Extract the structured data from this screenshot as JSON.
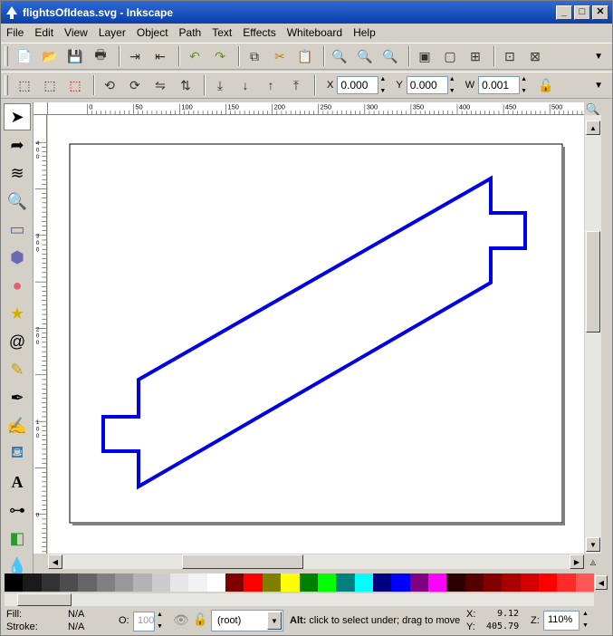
{
  "window": {
    "title": "flightsOfIdeas.svg - Inkscape",
    "minimize_icon": "minimize-icon",
    "maximize_icon": "maximize-icon",
    "close_icon": "close-icon"
  },
  "menu": [
    "File",
    "Edit",
    "View",
    "Layer",
    "Object",
    "Path",
    "Text",
    "Effects",
    "Whiteboard",
    "Help"
  ],
  "toolbar_commands": [
    "new-document-icon",
    "open-icon",
    "save-icon",
    "print-icon",
    "import-icon",
    "export-icon",
    "undo-icon",
    "redo-icon",
    "duplicate-icon",
    "cut-icon",
    "paste-icon",
    "zoom-selection-icon",
    "zoom-drawing-icon",
    "zoom-page-icon",
    "group-icon",
    "ungroup-icon",
    "align-icon",
    "fill-stroke-icon",
    "xml-editor-icon"
  ],
  "selector_toolbar": {
    "x_label": "X",
    "x_value": "0.000",
    "y_label": "Y",
    "y_value": "0.000",
    "w_label": "W",
    "w_value": "0.001",
    "lock_icon": "lock-icon"
  },
  "tools": [
    "selector-tool-icon",
    "node-tool-icon",
    "tweak-tool-icon",
    "zoom-tool-icon",
    "rectangle-tool-icon",
    "3d-box-tool-icon",
    "ellipse-tool-icon",
    "star-tool-icon",
    "spiral-tool-icon",
    "pencil-tool-icon",
    "pen-tool-icon",
    "calligraphy-tool-icon",
    "paint-bucket-tool-icon",
    "text-tool-icon",
    "connector-tool-icon",
    "gradient-tool-icon",
    "dropper-tool-icon"
  ],
  "ruler_top_ticks": [
    "0",
    "50",
    "100",
    "150",
    "200",
    "250",
    "300",
    "350",
    "400",
    "450",
    "500"
  ],
  "ruler_left_ticks": [
    "400",
    "300",
    "200",
    "100",
    "0"
  ],
  "canvas": {
    "stroke_color": "#0000e6"
  },
  "palette": [
    "#000000",
    "#1a1a1a",
    "#333333",
    "#4d4d4d",
    "#666666",
    "#808080",
    "#999999",
    "#b3b3b3",
    "#cccccc",
    "#e6e6e6",
    "#f2f2f2",
    "#ffffff",
    "#800000",
    "#ff0000",
    "#808000",
    "#ffff00",
    "#008000",
    "#00ff00",
    "#008080",
    "#00ffff",
    "#000080",
    "#0000ff",
    "#800080",
    "#ff00ff",
    "#2b0000",
    "#550000",
    "#800000",
    "#aa0000",
    "#d40000",
    "#ff0000",
    "#ff2a2a",
    "#ff5555"
  ],
  "status": {
    "fill_label": "Fill:",
    "fill_value": "N/A",
    "stroke_label": "Stroke:",
    "stroke_value": "N/A",
    "opacity_label": "O:",
    "opacity_value": "100",
    "layer_value": "(root)",
    "message_bold": "Alt:",
    "message": " click to select under; drag to move",
    "x_label": "X:",
    "x_value": "9.12",
    "y_label": "Y:",
    "y_value": "405.79",
    "zoom_label": "Z:",
    "zoom_value": "110%"
  }
}
